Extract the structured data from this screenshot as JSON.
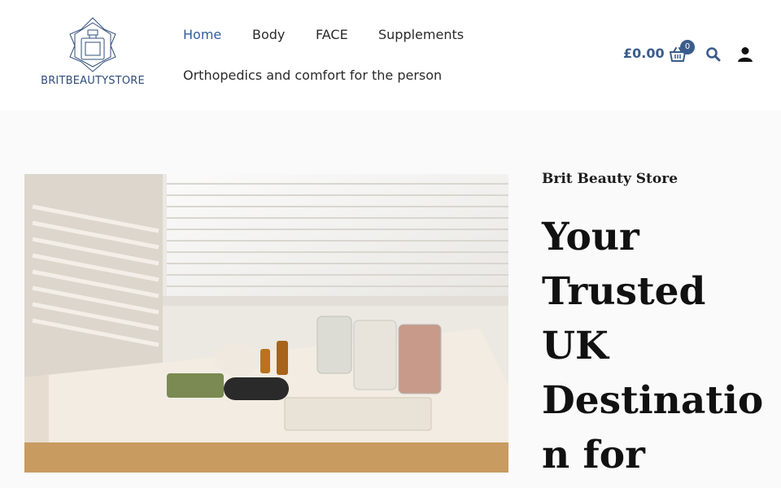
{
  "brand": {
    "name": "BRITBEAUTYSTORE",
    "color": "#2f4d7a"
  },
  "nav": {
    "items": [
      {
        "label": "Home",
        "active": true
      },
      {
        "label": "Body",
        "active": false
      },
      {
        "label": "FACE",
        "active": false
      },
      {
        "label": "Supplements",
        "active": false
      },
      {
        "label": "Orthopedics and comfort for the person",
        "active": false
      }
    ]
  },
  "cart": {
    "total": "£0.00",
    "count": "0",
    "icon": "basket-icon"
  },
  "actions": {
    "search_icon": "search-icon",
    "account_icon": "user-icon"
  },
  "hero": {
    "kicker": "Brit Beauty Store",
    "headline_lines": [
      "Your",
      "Trusted",
      "UK",
      "Destinatio",
      "n for"
    ],
    "image": "spa-table-with-natural-products"
  },
  "colors": {
    "accent": "#3a5c8a",
    "active_nav": "#2f5f9f",
    "background": "#fbfafa"
  }
}
